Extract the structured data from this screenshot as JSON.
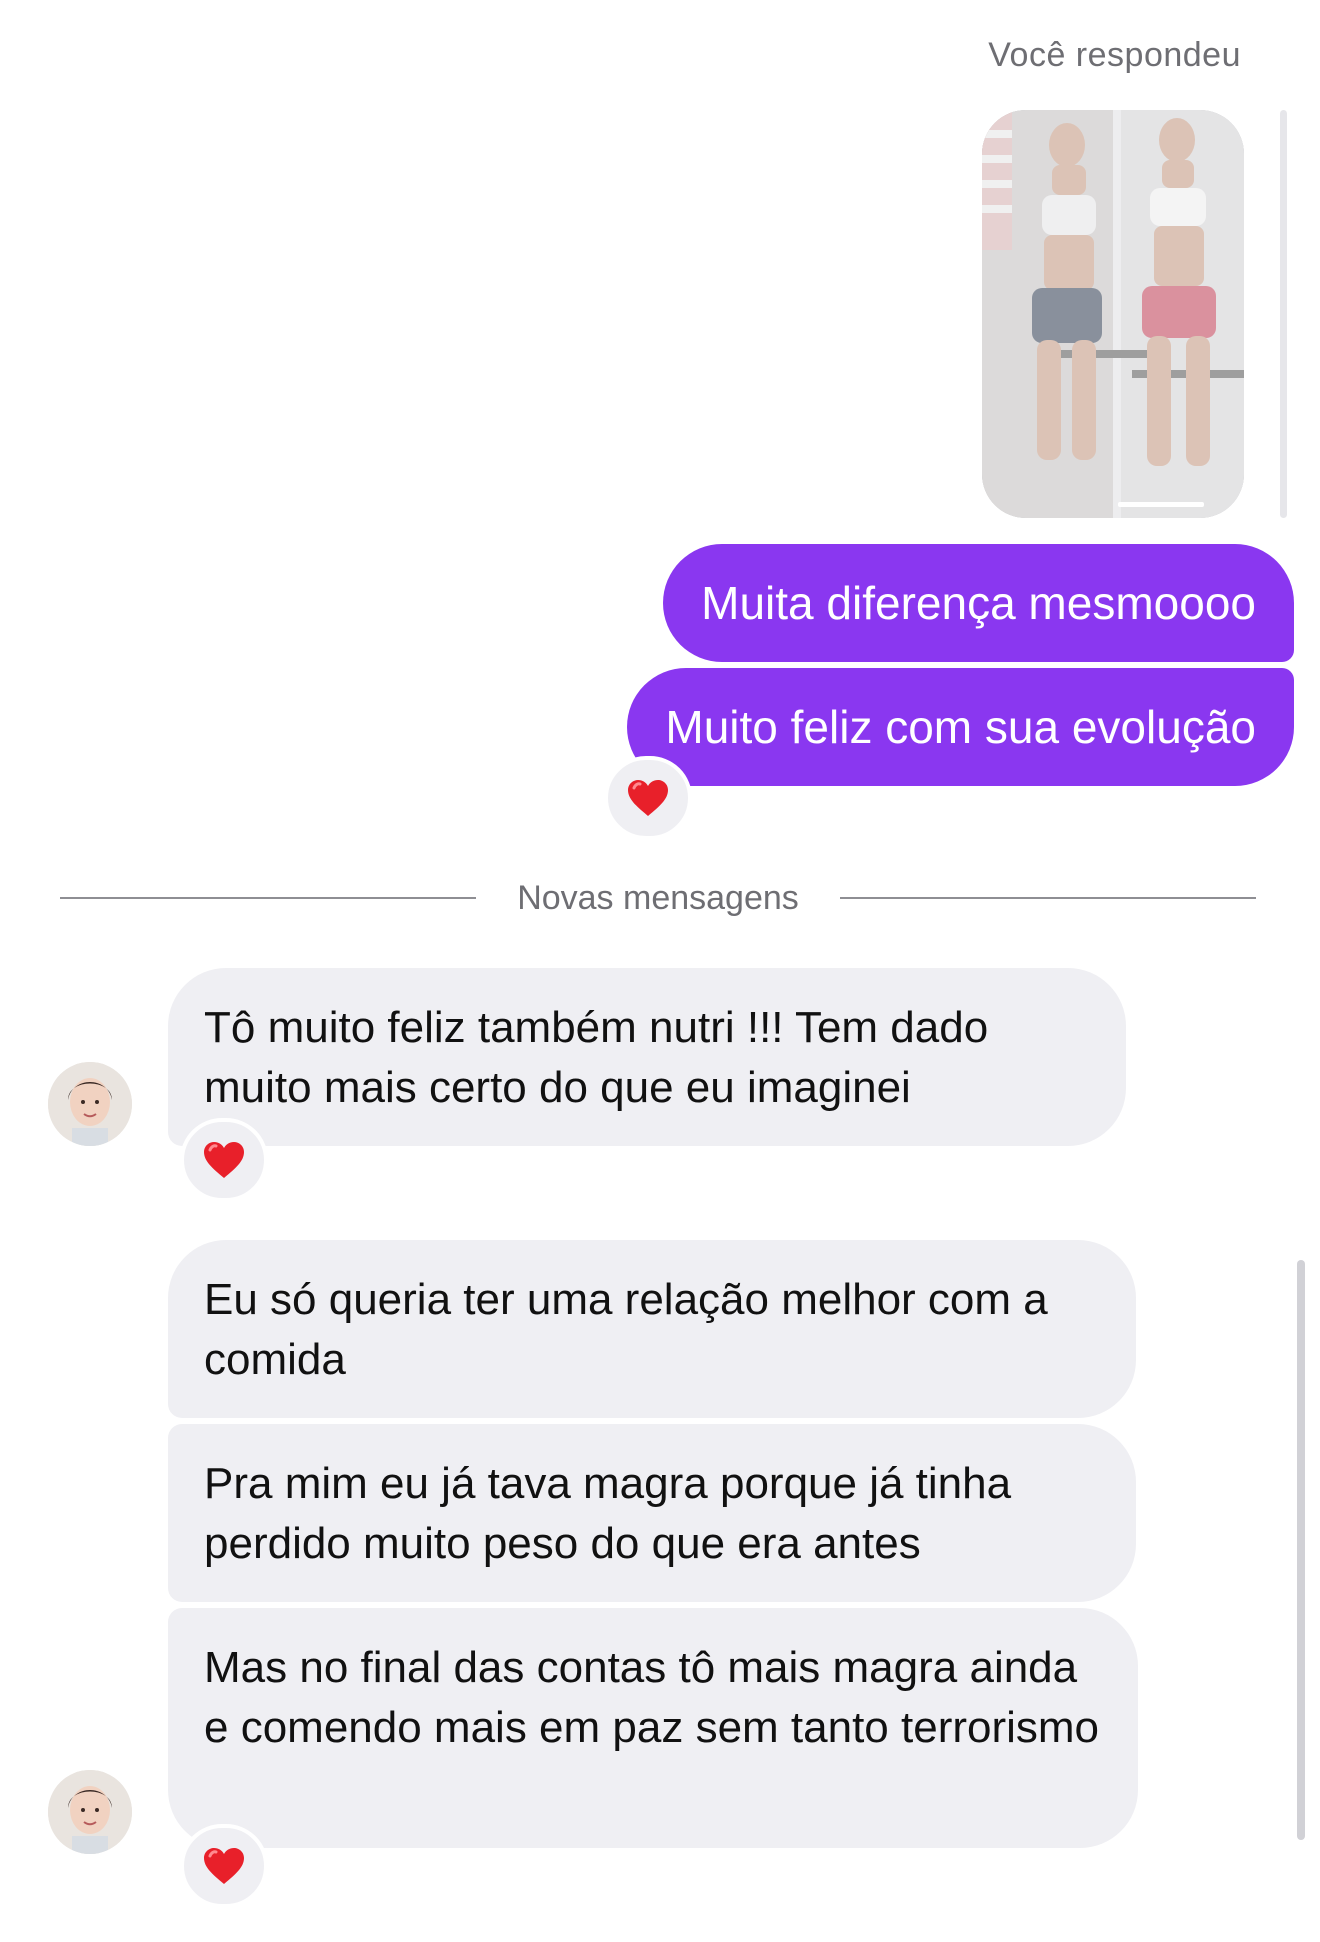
{
  "header": {
    "reply_label": "Você respondeu"
  },
  "outgoing_messages": [
    {
      "text": "Muita diferença mesmoooo"
    },
    {
      "text": "Muito feliz com sua evolução"
    }
  ],
  "divider": {
    "label": "Novas mensagens"
  },
  "incoming_messages": [
    {
      "text": "Tô muito feliz também nutri !!! Tem dado muito mais certo do que eu imaginei"
    },
    {
      "text": "Eu só queria ter uma relação melhor com a comida"
    },
    {
      "text": "Pra mim eu já tava magra porque já tinha perdido muito peso do que era antes"
    },
    {
      "text": "Mas no final das contas tô mais magra ainda e comendo mais em paz sem tanto terrorismo"
    }
  ],
  "reactions": {
    "icon": "red-heart-icon",
    "color": "#e8202a"
  },
  "colors": {
    "outgoing_bubble": "#8a37f0",
    "incoming_bubble": "#efeff3"
  }
}
